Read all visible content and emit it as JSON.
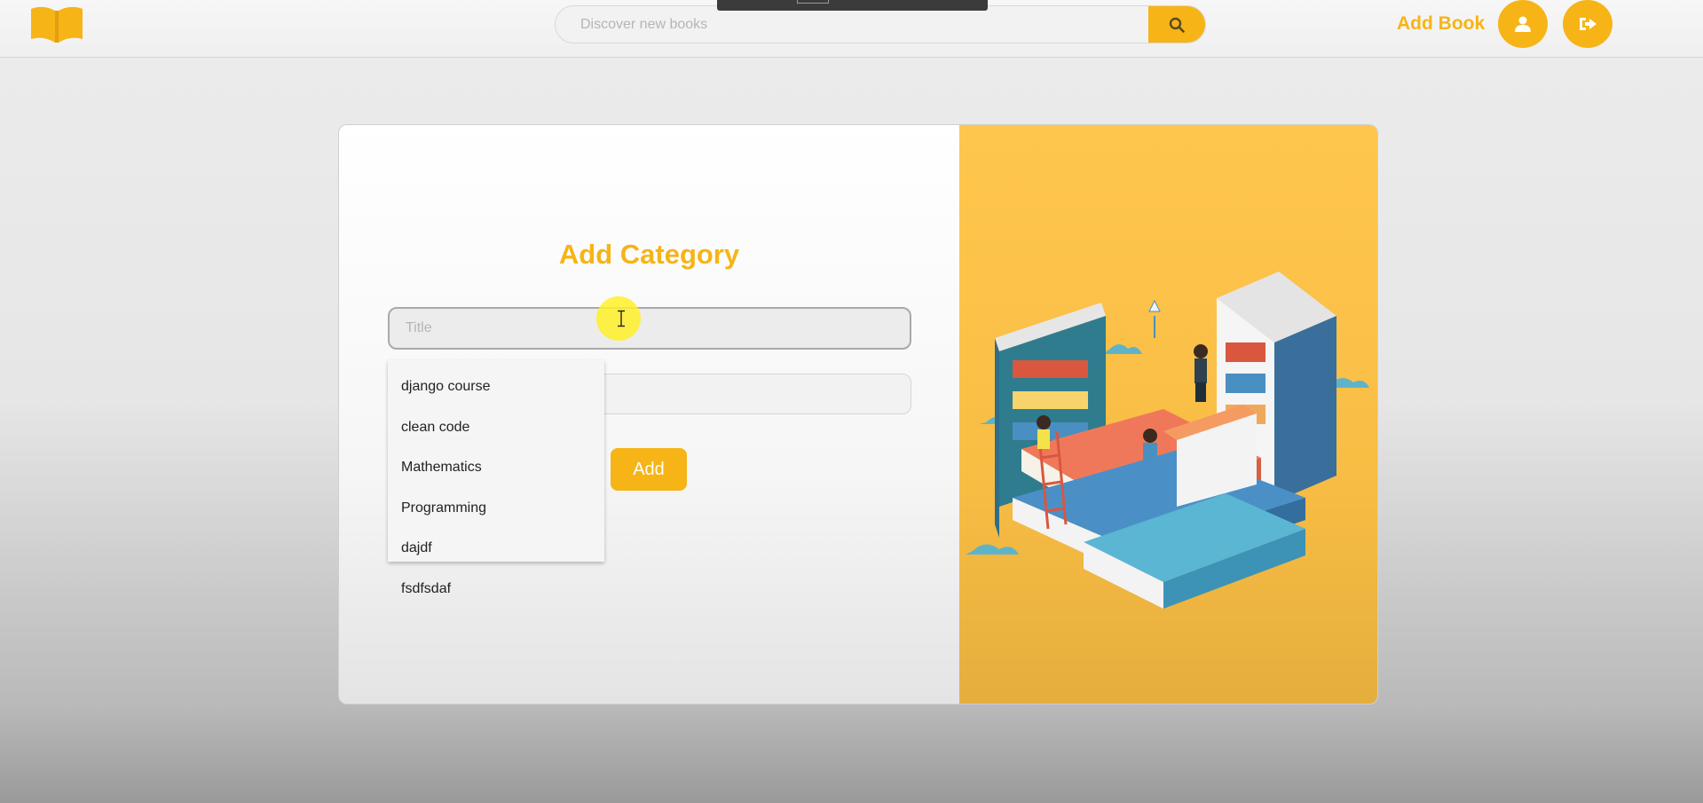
{
  "navbar": {
    "logo_icon": "open-book-icon",
    "search": {
      "placeholder": "Discover new books",
      "value": "",
      "button_icon": "search-icon"
    },
    "add_book_label": "Add Book",
    "profile_icon": "user-icon",
    "logout_icon": "sign-out-icon"
  },
  "form": {
    "title": "Add Category",
    "title_input": {
      "placeholder": "Title",
      "value": ""
    },
    "second_input": {
      "value": ""
    },
    "add_label": "Add"
  },
  "suggestions": [
    {
      "label": "django course"
    },
    {
      "label": "clean code"
    },
    {
      "label": "Mathematics"
    },
    {
      "label": "Programming"
    },
    {
      "label": "dajdf"
    },
    {
      "label": "fsdfsdaf"
    }
  ],
  "illustration": {
    "name": "isometric-library-illustration"
  },
  "colors": {
    "accent": "#f6b417",
    "panel": "#ffc64e",
    "background": "#ececec"
  }
}
